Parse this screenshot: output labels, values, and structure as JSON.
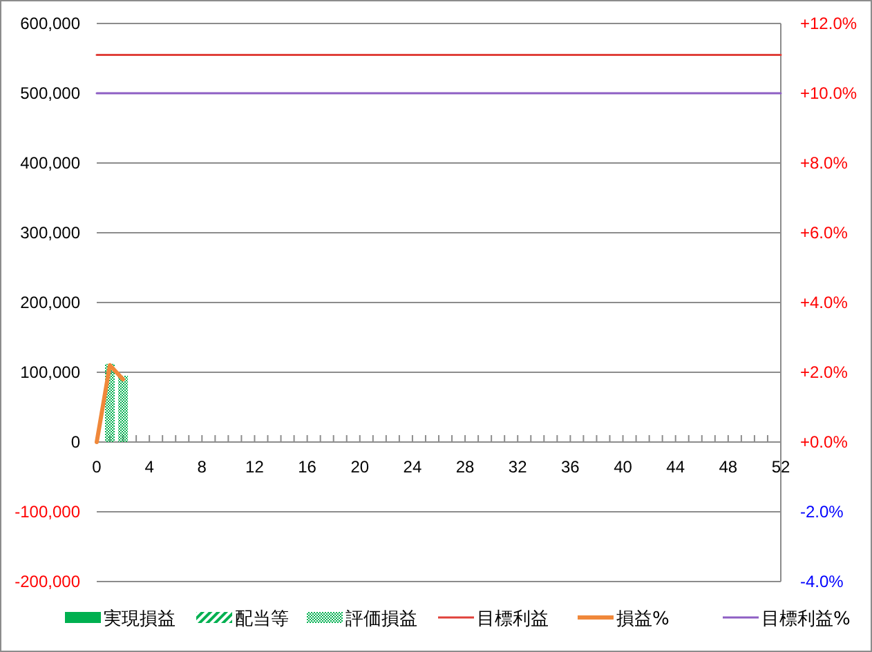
{
  "chart_data": {
    "type": "bar",
    "stacked": true,
    "grid": true,
    "legend": true,
    "x": [
      0,
      1,
      2,
      3,
      4,
      5,
      6,
      7,
      8,
      9,
      10,
      11,
      12,
      13,
      14,
      15,
      16,
      17,
      18,
      19,
      20,
      21,
      22,
      23,
      24,
      25,
      26,
      27,
      28,
      29,
      30,
      31,
      32,
      33,
      34,
      35,
      36,
      37,
      38,
      39,
      40,
      41,
      42,
      43,
      44,
      45,
      46,
      47,
      48,
      49,
      50,
      51,
      52
    ],
    "xlim": [
      0,
      52
    ],
    "ylim": [
      -200000,
      600000
    ],
    "y2lim": [
      -4,
      12
    ],
    "xticks": [
      0,
      4,
      8,
      12,
      16,
      20,
      24,
      28,
      32,
      36,
      40,
      44,
      48,
      52
    ],
    "yticks": [
      {
        "value": 600000,
        "label": "600,000"
      },
      {
        "value": 500000,
        "label": "500,000"
      },
      {
        "value": 400000,
        "label": "400,000"
      },
      {
        "value": 300000,
        "label": "300,000"
      },
      {
        "value": 200000,
        "label": "200,000"
      },
      {
        "value": 100000,
        "label": "100,000"
      },
      {
        "value": 0,
        "label": "0"
      },
      {
        "value": -100000,
        "label": "-100,000"
      },
      {
        "value": -200000,
        "label": "-200,000"
      }
    ],
    "y2ticks": [
      {
        "value": 12,
        "label": "+12.0%"
      },
      {
        "value": 10,
        "label": "+10.0%"
      },
      {
        "value": 8,
        "label": "+8.0%"
      },
      {
        "value": 6,
        "label": "+6.0%"
      },
      {
        "value": 4,
        "label": "+4.0%"
      },
      {
        "value": 2,
        "label": "+2.0%"
      },
      {
        "value": 0,
        "label": "+0.0%"
      },
      {
        "value": -2,
        "label": "-2.0%"
      },
      {
        "value": -4,
        "label": "-4.0%"
      }
    ],
    "series": [
      {
        "name": "実現損益",
        "color": "#00b050",
        "values": [
          null,
          null,
          null,
          null,
          null,
          null,
          null,
          null,
          null,
          null,
          null,
          null,
          null,
          null,
          null,
          null,
          null,
          null,
          null,
          null,
          null,
          null,
          null,
          null,
          null,
          null,
          null,
          null,
          null,
          null,
          null,
          null,
          null,
          null,
          null,
          null,
          null,
          null,
          null,
          null,
          null,
          null,
          null,
          null,
          null,
          null,
          null,
          null,
          null,
          null,
          null,
          null,
          null
        ]
      },
      {
        "name": "配当等",
        "color": "#00b050",
        "values": [
          null,
          null,
          null,
          null,
          null,
          null,
          null,
          null,
          null,
          null,
          null,
          null,
          null,
          null,
          null,
          null,
          null,
          null,
          null,
          null,
          null,
          null,
          null,
          null,
          null,
          null,
          null,
          null,
          null,
          null,
          null,
          null,
          null,
          null,
          null,
          null,
          null,
          null,
          null,
          null,
          null,
          null,
          null,
          null,
          null,
          null,
          null,
          null,
          null,
          null,
          null,
          null,
          null
        ]
      },
      {
        "name": "評価損益",
        "color": "#00b050",
        "values": [
          null,
          112000,
          95000,
          null,
          null,
          null,
          null,
          null,
          null,
          null,
          null,
          null,
          null,
          null,
          null,
          null,
          null,
          null,
          null,
          null,
          null,
          null,
          null,
          null,
          null,
          null,
          null,
          null,
          null,
          null,
          null,
          null,
          null,
          null,
          null,
          null,
          null,
          null,
          null,
          null,
          null,
          null,
          null,
          null,
          null,
          null,
          null,
          null,
          null,
          null,
          null,
          null,
          null
        ]
      },
      {
        "name": "目標利益",
        "type": "line",
        "color": "#e0403a",
        "values": [
          555000,
          555000,
          555000,
          555000,
          555000,
          555000,
          555000,
          555000,
          555000,
          555000,
          555000,
          555000,
          555000,
          555000,
          555000,
          555000,
          555000,
          555000,
          555000,
          555000,
          555000,
          555000,
          555000,
          555000,
          555000,
          555000,
          555000,
          555000,
          555000,
          555000,
          555000,
          555000,
          555000,
          555000,
          555000,
          555000,
          555000,
          555000,
          555000,
          555000,
          555000,
          555000,
          555000,
          555000,
          555000,
          555000,
          555000,
          555000,
          555000,
          555000,
          555000,
          555000,
          555000
        ]
      },
      {
        "name": "損益%",
        "type": "line",
        "axis": "y2",
        "color": "#f0883a",
        "values": [
          0,
          2.2,
          1.8,
          null,
          null,
          null,
          null,
          null,
          null,
          null,
          null,
          null,
          null,
          null,
          null,
          null,
          null,
          null,
          null,
          null,
          null,
          null,
          null,
          null,
          null,
          null,
          null,
          null,
          null,
          null,
          null,
          null,
          null,
          null,
          null,
          null,
          null,
          null,
          null,
          null,
          null,
          null,
          null,
          null,
          null,
          null,
          null,
          null,
          null,
          null,
          null,
          null,
          null
        ]
      },
      {
        "name": "目標利益%",
        "type": "line",
        "axis": "y2",
        "color": "#8e5fc4",
        "values": [
          10,
          10,
          10,
          10,
          10,
          10,
          10,
          10,
          10,
          10,
          10,
          10,
          10,
          10,
          10,
          10,
          10,
          10,
          10,
          10,
          10,
          10,
          10,
          10,
          10,
          10,
          10,
          10,
          10,
          10,
          10,
          10,
          10,
          10,
          10,
          10,
          10,
          10,
          10,
          10,
          10,
          10,
          10,
          10,
          10,
          10,
          10,
          10,
          10,
          10,
          10,
          10,
          10
        ]
      }
    ]
  }
}
